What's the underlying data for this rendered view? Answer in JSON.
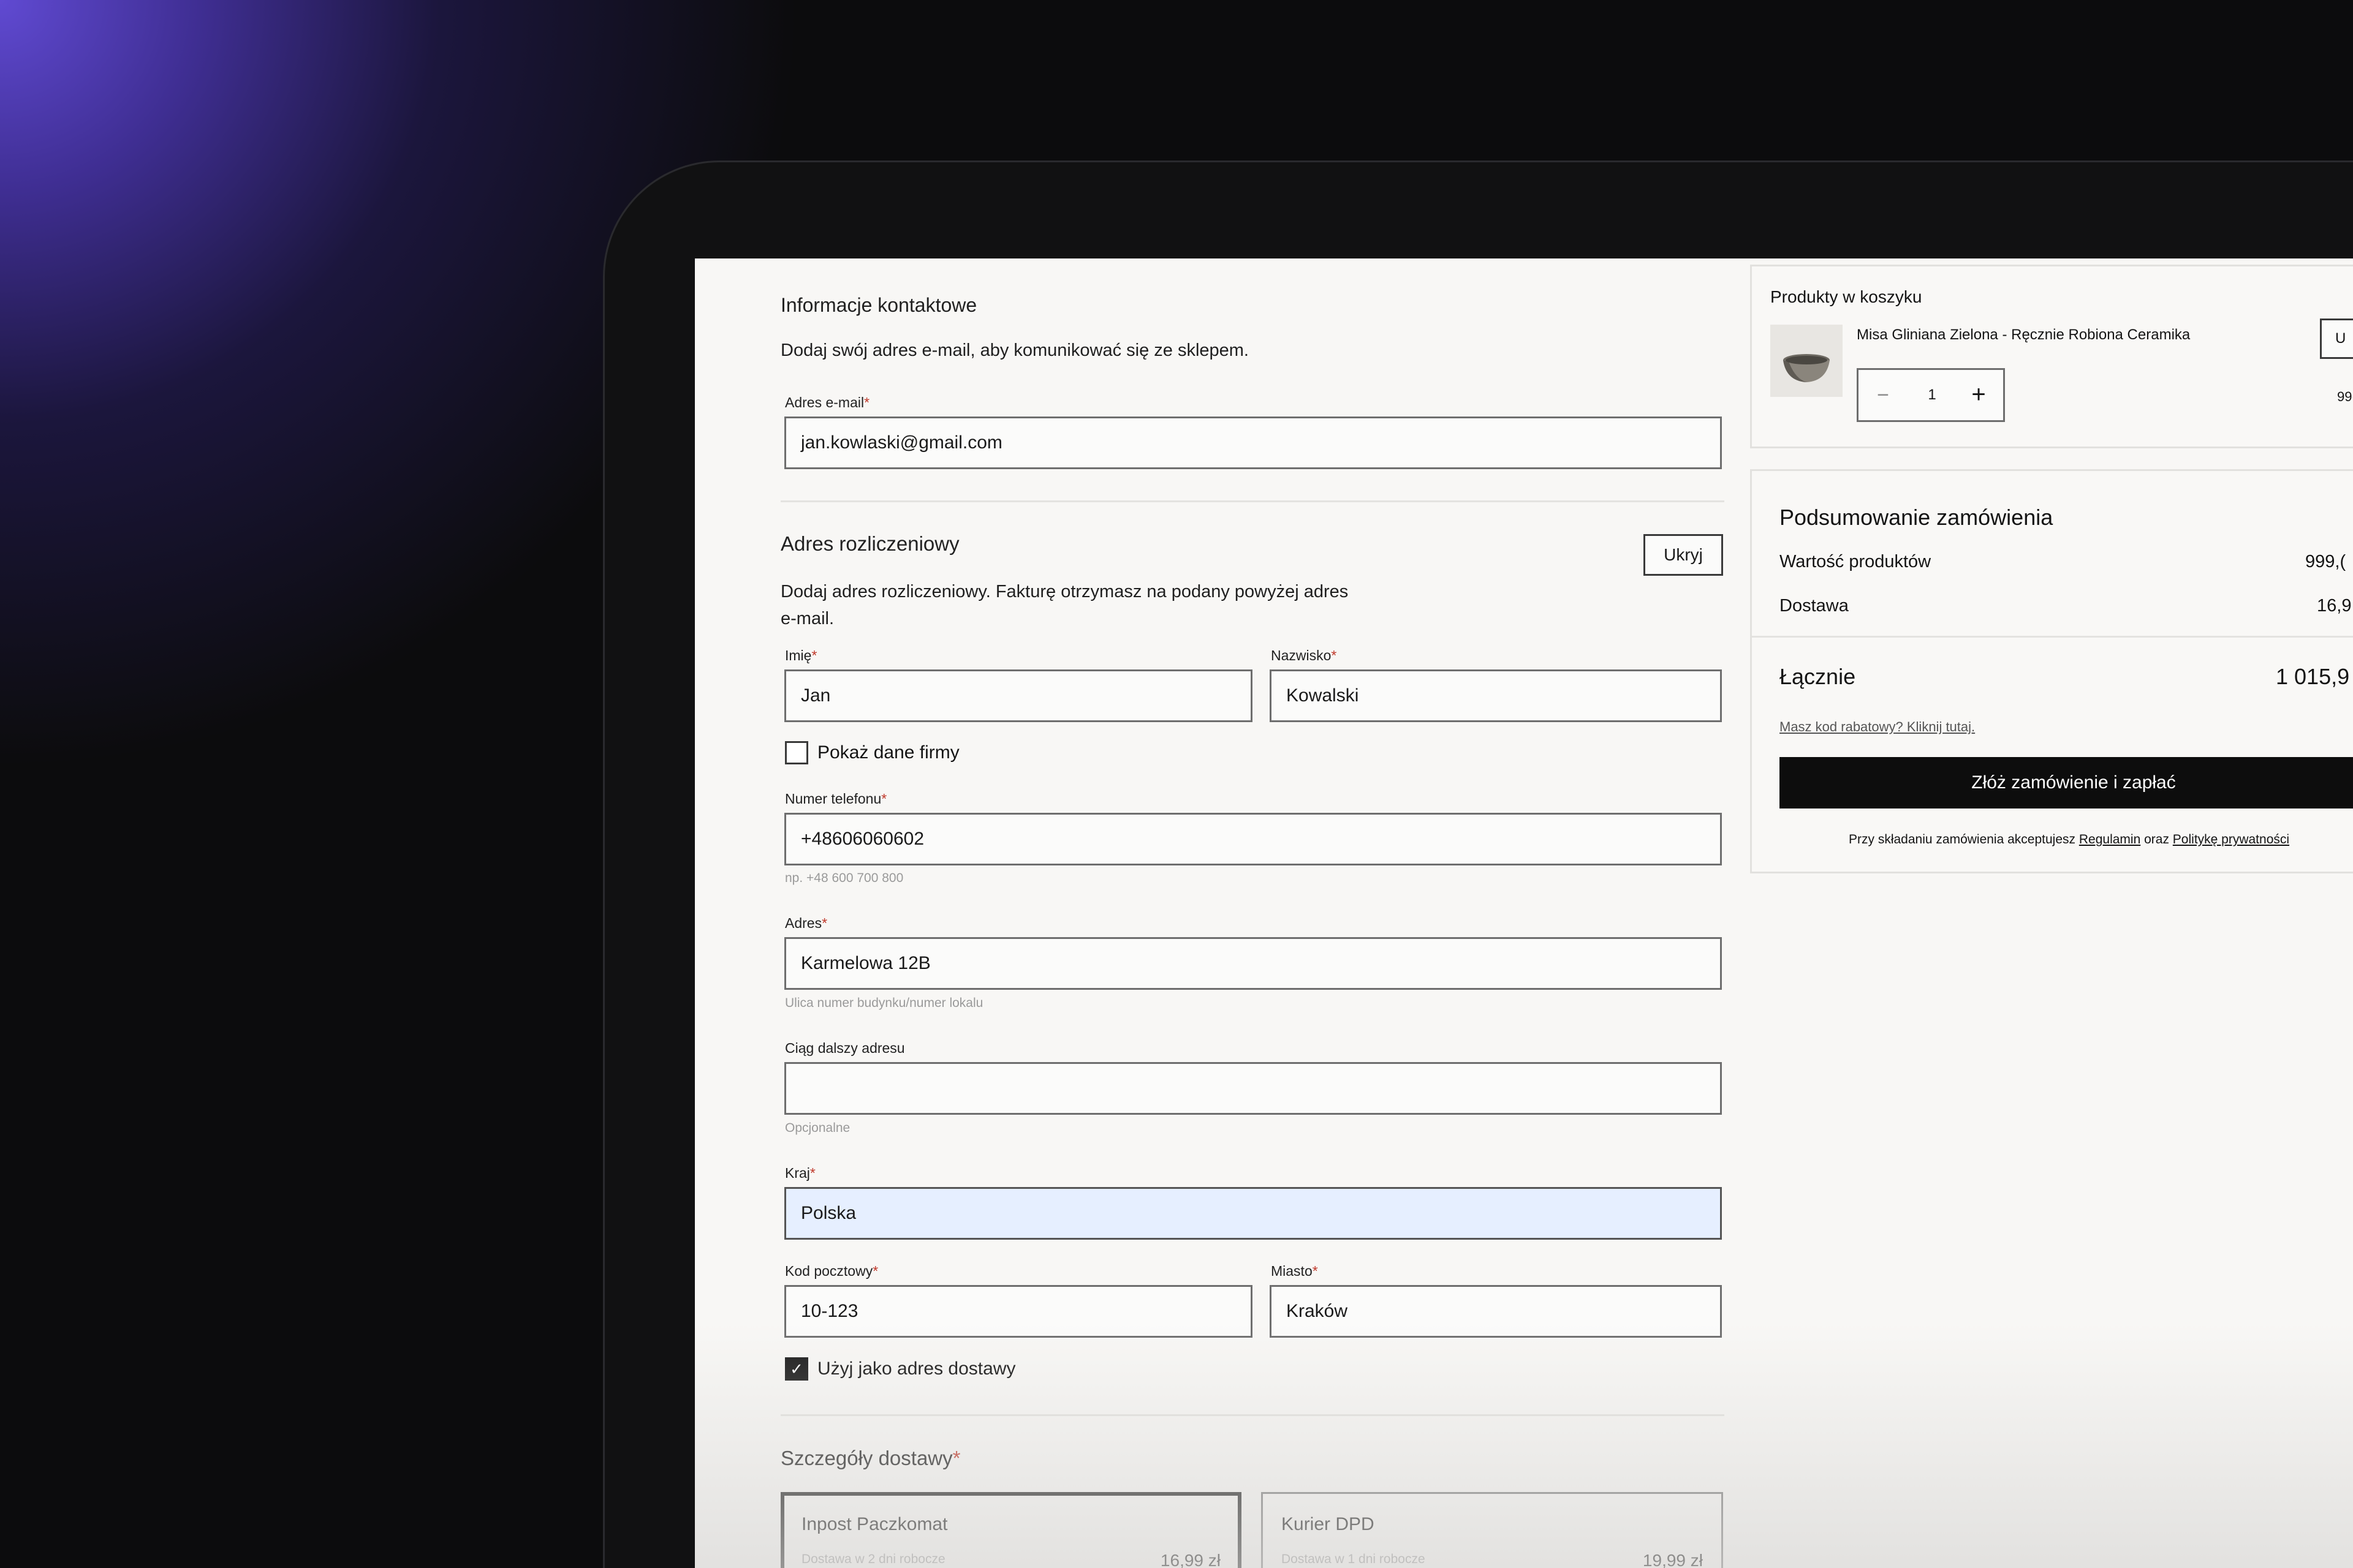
{
  "contact": {
    "title": "Informacje kontaktowe",
    "description": "Dodaj swój adres e-mail, aby komunikować się ze sklepem.",
    "email_label": "Adres e-mail",
    "email_value": "jan.kowlaski@gmail.com"
  },
  "required_mark": "*",
  "billing": {
    "title": "Adres rozliczeniowy",
    "hide_button": "Ukryj",
    "description_line1": "Dodaj adres rozliczeniowy. Fakturę otrzymasz na podany powyżej adres",
    "description_line2": "e-mail.",
    "first_name_label": "Imię",
    "first_name_value": "Jan",
    "last_name_label": "Nazwisko",
    "last_name_value": "Kowalski",
    "company_checkbox_label": "Pokaż dane firmy",
    "company_checked": false,
    "phone_label": "Numer telefonu",
    "phone_value": "+48606060602",
    "phone_hint": "np. +48 600 700 800",
    "address_label": "Adres",
    "address_value": "Karmelowa 12B",
    "address_hint": "Ulica numer budynku/numer lokalu",
    "address2_label": "Ciąg dalszy adresu",
    "address2_value": "",
    "address2_hint": "Opcjonalne",
    "country_label": "Kraj",
    "country_value": "Polska",
    "postal_label": "Kod pocztowy",
    "postal_value": "10-123",
    "city_label": "Miasto",
    "city_value": "Kraków",
    "use_as_shipping_label": "Użyj jako adres dostawy",
    "use_as_shipping_checked": true,
    "check_glyph": "✓"
  },
  "shipping": {
    "title": "Szczegóły dostawy",
    "options": [
      {
        "name": "Inpost Paczkomat",
        "sub": "Dostawa w 2 dni robocze",
        "price": "16,99 zł",
        "selected": true
      },
      {
        "name": "Kurier DPD",
        "sub": "Dostawa w 1 dni robocze",
        "price": "19,99 zł",
        "selected": false
      }
    ]
  },
  "cart": {
    "title": "Produkty w koszyku",
    "item_name": "Misa Gliniana Zielona - Ręcznie Robiona Ceramika",
    "quantity": "1",
    "minus_glyph": "−",
    "plus_glyph": "+",
    "remove_button_partial": "U",
    "price_partial": "99("
  },
  "summary": {
    "title": "Podsumowanie zamówienia",
    "products_label": "Wartość produktów",
    "products_value_partial": "999,(",
    "shipping_label": "Dostawa",
    "shipping_value_partial": "16,9",
    "total_label": "Łącznie",
    "total_value_partial": "1 015,9",
    "discount_link": "Masz kod rabatowy? Kliknij tutaj.",
    "submit_button": "Złóż zamówienie i zapłać",
    "terms_prefix": "Przy składaniu zamówienia akceptujesz",
    "terms_link": "Regulamin",
    "terms_and": "oraz",
    "privacy_link": "Politykę prywatności"
  },
  "colors": {
    "background": "#0c0c0d",
    "glow": "#5a46cc",
    "screen": "#f8f7f5",
    "focused_input": "#e6efff",
    "primary_button": "#0d0d0d",
    "required": "#c0392b"
  }
}
